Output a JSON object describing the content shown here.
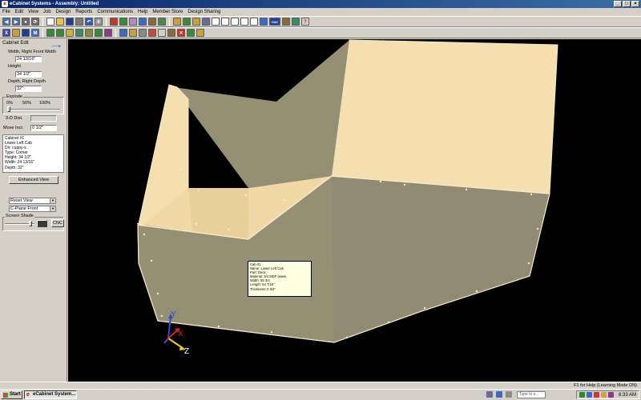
{
  "window": {
    "title": "eCabinet Systems - Assembly: Untitled",
    "app_icon": "e",
    "controls": [
      "_",
      "□",
      "×"
    ]
  },
  "menu": [
    "File",
    "Edit",
    "View",
    "Job",
    "Design",
    "Reports",
    "Communications",
    "Help",
    "Member Store",
    "Design Sharing"
  ],
  "toolbar1": [
    {
      "icon": "back-arrow-icon",
      "color": "#4a6ea8",
      "glyph": "◀"
    },
    {
      "icon": "forward-arrow-icon",
      "color": "#4a6ea8",
      "glyph": "▶"
    },
    {
      "icon": "stop-icon",
      "color": "#6a6a6a",
      "glyph": "●"
    },
    {
      "icon": "refresh-icon",
      "color": "#6a6a6a",
      "glyph": "⟳"
    },
    {
      "sep": true
    },
    {
      "icon": "new-file-icon",
      "color": "#ffffff",
      "glyph": ""
    },
    {
      "icon": "open-folder-icon",
      "color": "#e6c34a",
      "glyph": ""
    },
    {
      "icon": "save-icon",
      "color": "#1f3f8f",
      "glyph": ""
    },
    {
      "icon": "print-icon",
      "color": "#7a7a7a",
      "glyph": ""
    },
    {
      "icon": "undo-icon",
      "color": "#2a5ab8",
      "glyph": "↶"
    },
    {
      "icon": "grid-icon",
      "color": "#9a9a9a",
      "glyph": "#"
    },
    {
      "sep": true
    },
    {
      "icon": "color-icon",
      "color": "#c03a2a",
      "glyph": ""
    },
    {
      "icon": "tree-icon",
      "color": "#3a8a3a",
      "glyph": ""
    },
    {
      "icon": "material-icon",
      "color": "#b48ac0",
      "glyph": ""
    },
    {
      "icon": "edge-icon",
      "color": "#3a6ac8",
      "glyph": ""
    },
    {
      "icon": "hardware-icon",
      "color": "#8a6a3a",
      "glyph": ""
    },
    {
      "icon": "door-icon",
      "color": "#4a8a4a",
      "glyph": ""
    },
    {
      "sep": true
    },
    {
      "icon": "part-icon",
      "color": "#c8a03a",
      "glyph": ""
    },
    {
      "icon": "cabinet-icon",
      "color": "#3a8a3a",
      "glyph": ""
    },
    {
      "icon": "drawer-icon",
      "color": "#c8a03a",
      "glyph": ""
    },
    {
      "icon": "shelf-icon",
      "color": "#6a6a9a",
      "glyph": ""
    },
    {
      "icon": "report-icon",
      "color": "#ffffff",
      "glyph": ""
    },
    {
      "icon": "report2-icon",
      "color": "#ffffff",
      "glyph": ""
    },
    {
      "icon": "report3-icon",
      "color": "#ffffff",
      "glyph": ""
    },
    {
      "icon": "list-icon",
      "color": "#ffffff",
      "glyph": ""
    },
    {
      "icon": "cutlist-icon",
      "color": "#ffffff",
      "glyph": ""
    },
    {
      "icon": "network-icon",
      "color": "#3a6ac8",
      "glyph": ""
    },
    {
      "icon": "cnc-icon",
      "color": "#1e3f9a",
      "glyph": "CNC"
    },
    {
      "icon": "machine-icon",
      "color": "#8a6a3a",
      "glyph": ""
    },
    {
      "icon": "settings-icon",
      "color": "#3a8a6a",
      "glyph": ""
    },
    {
      "icon": "help-icon",
      "color": "#d4d0c8",
      "glyph": "?"
    }
  ],
  "toolbar2": [
    {
      "icon": "close-x-icon",
      "color": "#3a4aa8",
      "glyph": "X"
    },
    {
      "icon": "open-icon",
      "color": "#c8a03a",
      "glyph": ""
    },
    {
      "icon": "save-disk-icon",
      "color": "#1f3f8f",
      "glyph": ""
    },
    {
      "icon": "main-icon",
      "color": "#3a6ac8",
      "glyph": "M"
    },
    {
      "sep": true
    },
    {
      "icon": "cab-green-icon",
      "color": "#3a8a3a",
      "glyph": ""
    },
    {
      "icon": "cab-door-icon",
      "color": "#3a8a3a",
      "glyph": ""
    },
    {
      "icon": "cab-drawer-icon",
      "color": "#c8b03a",
      "glyph": ""
    },
    {
      "icon": "cab-face-icon",
      "color": "#3a8a6a",
      "glyph": ""
    },
    {
      "icon": "cab-corner-icon",
      "color": "#8a8a3a",
      "glyph": ""
    },
    {
      "icon": "cab-tall-icon",
      "color": "#3a8a3a",
      "glyph": ""
    },
    {
      "icon": "cab-rotate-icon",
      "color": "#8a3a8a",
      "glyph": ""
    },
    {
      "sep": true
    },
    {
      "icon": "view-icon",
      "color": "#3a6ac8",
      "glyph": ""
    },
    {
      "icon": "layout-icon",
      "color": "#c8a03a",
      "glyph": ""
    },
    {
      "icon": "camera-icon",
      "color": "#8a8a8a",
      "glyph": ""
    },
    {
      "icon": "measure-icon",
      "color": "#c84a3a",
      "glyph": ""
    },
    {
      "icon": "spacer-icon",
      "color": "#d4d0c8",
      "glyph": ""
    },
    {
      "icon": "divider-icon",
      "color": "#8a6a3a",
      "glyph": ""
    },
    {
      "icon": "delete-icon",
      "color": "#d03020",
      "glyph": "✕"
    },
    {
      "icon": "panel-icon",
      "color": "#3a8a3a",
      "glyph": ""
    },
    {
      "icon": "assemble-icon",
      "color": "#c8a03a",
      "glyph": ""
    }
  ],
  "left_panel": {
    "title": "Cabinet Edit",
    "width_label": "Width, Right Front Width",
    "width_value": "24 13/16\"",
    "height_label": "Height",
    "height_value": "34 1/2\"",
    "depth_label": "Depth, Right Depth",
    "depth_value": "32\"",
    "explode_label": "Explode",
    "explode_ticks": [
      "0%",
      "50%",
      "100%"
    ],
    "explode_value": 0,
    "dist_label": "3-D Dist.",
    "move_label": "Move Incr.",
    "move_value": "0 1/2\"",
    "info_lines": [
      "Cabinet #1",
      "Lower Left Cab",
      "Dir: cuppy-s",
      "Type: Corner",
      "Height: 34 1/2\"",
      "Width: 24 13/16\"",
      "Depth: 32\""
    ],
    "enhanced_button": "Enhanced View",
    "view_select": "Reset View",
    "plane_select": "C-Plane Front",
    "shade_label": "Screen Shade",
    "shade_value": 0.9,
    "cnc_button": "CNC"
  },
  "tooltip": {
    "lines": [
      "Cab #1",
      "Name: Lower Left Cab",
      "Part: Deck",
      "Material: 3/4 MDF (www.",
      "Width: 55 3/4",
      "Length: 54 7/16\"",
      "Thickness: 0 3/4\""
    ]
  },
  "axes": {
    "x": "X",
    "y": "Y",
    "z": "Z"
  },
  "colors": {
    "panel_face": "#f3dfb0",
    "panel_gray": "#958f76",
    "panel_gray_dark": "#8a8470",
    "edge": "#f7e9c4",
    "background": "#000000"
  },
  "status": {
    "text": "F1 for Help (Learning Mode ON)"
  },
  "taskbar": {
    "start": "Start",
    "task_item": "eCabinet System...",
    "search_placeholder": "Type to s...",
    "clock": "8:33 AM"
  }
}
